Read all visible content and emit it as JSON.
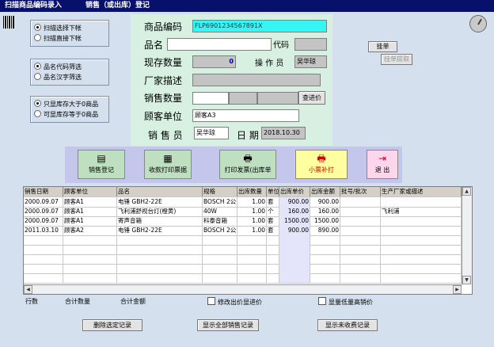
{
  "titlebar": {
    "left": "扫描商品编码录入",
    "right": "销售（或出库）登记"
  },
  "options": {
    "scan": [
      "扫描选择下帐",
      "扫描直接下帐"
    ],
    "filter": [
      "品名代码筛选",
      "品名汉字筛选"
    ],
    "stock": [
      "只显库存大于0商品",
      "可显库存等于0商品"
    ]
  },
  "form": {
    "code_label": "商品编码",
    "code_value": "FLP6901234567891X",
    "name_label": "品名",
    "name_value": "",
    "dm_label": "代码",
    "dm_value": "",
    "stock_label": "现存数量",
    "stock_value": "0",
    "operator_label": "操 作 员",
    "operator_value": "吴华琼",
    "maker_label": "厂家描述",
    "maker_value": "",
    "qty_label": "销售数量",
    "price_btn": "查进价",
    "cust_label": "顾客单位",
    "cust_value": "顾客A3",
    "seller_label": "销 售 员",
    "seller_value": "吴华琼",
    "date_label": "日 期",
    "date_value": "2018.10.30"
  },
  "side_buttons": {
    "hang": "挂单",
    "take": "挂单提取"
  },
  "toolbar": [
    "销售登记",
    "收款打印票据",
    "打印发票(出库单",
    "小票补打",
    "退 出"
  ],
  "table": {
    "headers": [
      "销售日期",
      "顾客单位",
      "品名",
      "规格",
      "出库数量",
      "单位",
      "出库单价",
      "出库金额",
      "批号/批次",
      "生产厂家或描述"
    ],
    "rows": [
      [
        "2000.09.07",
        "顾客A1",
        "电锤 GBH2-22E",
        "BOSCH 2公",
        "1.00",
        "套",
        "900.00",
        "900.00",
        "",
        ""
      ],
      [
        "2000.09.07",
        "顾客A1",
        "飞利浦舒视台灯(橙黄)",
        "40W",
        "1.00",
        "个",
        "160.00",
        "160.00",
        "",
        "飞利浦"
      ],
      [
        "2000.09.07",
        "顾客A1",
        "寄声音箱",
        "科泰音箱",
        "1.00",
        "套",
        "1500.00",
        "1500.00",
        "",
        ""
      ],
      [
        "2011.03.10",
        "顾客A2",
        "电锤 GBH2-22E",
        "BOSCH 2公",
        "1.00",
        "套",
        "900.00",
        "890.00",
        "",
        ""
      ]
    ]
  },
  "summary": {
    "rows": "行数",
    "qty": "合计数量",
    "amount": "合计金额",
    "chk1": "修改出价显进价",
    "chk2": "显量低量高销价"
  },
  "bottom_buttons": [
    "删除选定记录",
    "显示全部销售记录",
    "显示未收费记录"
  ]
}
